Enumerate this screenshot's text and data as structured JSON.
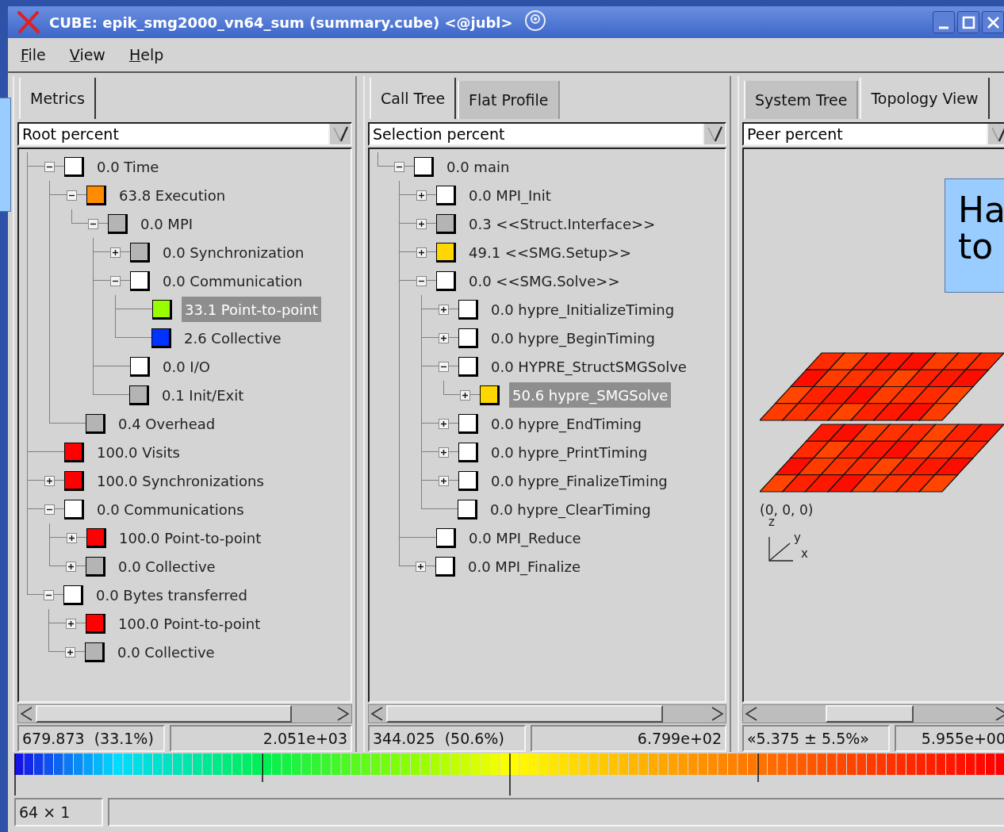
{
  "window": {
    "title": "CUBE: epik_smg2000_vn64_sum (summary.cube) <@jubl>"
  },
  "menu": [
    {
      "label": "File"
    },
    {
      "label": "View"
    },
    {
      "label": "Help"
    }
  ],
  "panels": [
    {
      "tabs": [
        {
          "label": "Metrics",
          "selected": true
        }
      ],
      "selector": {
        "value": "Root percent"
      },
      "view": {
        "kind": "tree",
        "nodes": [
          {
            "label": "0.0 Time",
            "kind": "branch",
            "expanded": true,
            "color": "#ffffff",
            "selected": false,
            "children": [
              {
                "label": "63.8 Execution",
                "kind": "branch",
                "expanded": true,
                "color": "#ff8c00",
                "selected": false,
                "children": [
                  {
                    "label": "0.0 MPI",
                    "kind": "branch",
                    "expanded": true,
                    "color": "#b4b4b4",
                    "selected": false,
                    "children": [
                      {
                        "label": "0.0 Synchronization",
                        "kind": "branch",
                        "expanded": false,
                        "color": "#b4b4b4",
                        "selected": false
                      },
                      {
                        "label": "0.0 Communication",
                        "kind": "branch",
                        "expanded": true,
                        "color": "#ffffff",
                        "selected": false,
                        "children": [
                          {
                            "label": "33.1 Point-to-point",
                            "kind": "leaf",
                            "color": "#99ff00",
                            "selected": true
                          },
                          {
                            "label": "2.6 Collective",
                            "kind": "leaf",
                            "color": "#0033ff",
                            "selected": false
                          }
                        ]
                      },
                      {
                        "label": "0.0 I/O",
                        "kind": "leaf",
                        "color": "#ffffff",
                        "selected": false
                      },
                      {
                        "label": "0.1 Init/Exit",
                        "kind": "leaf",
                        "color": "#b4b4b4",
                        "selected": false
                      }
                    ]
                  }
                ]
              },
              {
                "label": "0.4 Overhead",
                "kind": "leaf",
                "color": "#b4b4b4",
                "selected": false
              }
            ]
          },
          {
            "label": "100.0 Visits",
            "kind": "leaf",
            "color": "#ff0000",
            "selected": false
          },
          {
            "label": "100.0 Synchronizations",
            "kind": "branch",
            "expanded": false,
            "color": "#ff0000",
            "selected": false
          },
          {
            "label": "0.0 Communications",
            "kind": "branch",
            "expanded": true,
            "color": "#ffffff",
            "selected": false,
            "children": [
              {
                "label": "100.0 Point-to-point",
                "kind": "branch",
                "expanded": false,
                "color": "#ff0000",
                "selected": false
              },
              {
                "label": "0.0 Collective",
                "kind": "branch",
                "expanded": false,
                "color": "#b4b4b4",
                "selected": false
              }
            ]
          },
          {
            "label": "0.0 Bytes transferred",
            "kind": "branch",
            "expanded": true,
            "color": "#ffffff",
            "selected": false,
            "children": [
              {
                "label": "100.0 Point-to-point",
                "kind": "branch",
                "expanded": false,
                "color": "#ff0000",
                "selected": false
              },
              {
                "label": "0.0 Collective",
                "kind": "branch",
                "expanded": false,
                "color": "#b4b4b4",
                "selected": false
              }
            ]
          }
        ]
      },
      "values": {
        "left": "679.873  (33.1%)",
        "right": "2.051e+03"
      }
    },
    {
      "tabs": [
        {
          "label": "Call Tree",
          "selected": true
        },
        {
          "label": "Flat Profile",
          "selected": false
        }
      ],
      "selector": {
        "value": "Selection percent"
      },
      "view": {
        "kind": "tree",
        "nodes": [
          {
            "label": "0.0 main",
            "kind": "branch",
            "expanded": true,
            "color": "#ffffff",
            "selected": false,
            "children": [
              {
                "label": "0.0 MPI_Init",
                "kind": "branch",
                "expanded": false,
                "color": "#ffffff",
                "selected": false
              },
              {
                "label": "0.3 <<Struct.Interface>>",
                "kind": "branch",
                "expanded": false,
                "color": "#b4b4b4",
                "selected": false
              },
              {
                "label": "49.1 <<SMG.Setup>>",
                "kind": "branch",
                "expanded": false,
                "color": "#ffd700",
                "selected": false
              },
              {
                "label": "0.0 <<SMG.Solve>>",
                "kind": "branch",
                "expanded": true,
                "color": "#ffffff",
                "selected": false,
                "children": [
                  {
                    "label": "0.0 hypre_InitializeTiming",
                    "kind": "branch",
                    "expanded": false,
                    "color": "#ffffff",
                    "selected": false
                  },
                  {
                    "label": "0.0 hypre_BeginTiming",
                    "kind": "branch",
                    "expanded": false,
                    "color": "#ffffff",
                    "selected": false
                  },
                  {
                    "label": "0.0 HYPRE_StructSMGSolve",
                    "kind": "branch",
                    "expanded": true,
                    "color": "#ffffff",
                    "selected": false,
                    "children": [
                      {
                        "label": "50.6 hypre_SMGSolve",
                        "kind": "branch",
                        "expanded": false,
                        "color": "#ffd700",
                        "selected": true
                      }
                    ]
                  },
                  {
                    "label": "0.0 hypre_EndTiming",
                    "kind": "branch",
                    "expanded": false,
                    "color": "#ffffff",
                    "selected": false
                  },
                  {
                    "label": "0.0 hypre_PrintTiming",
                    "kind": "branch",
                    "expanded": false,
                    "color": "#ffffff",
                    "selected": false
                  },
                  {
                    "label": "0.0 hypre_FinalizeTiming",
                    "kind": "branch",
                    "expanded": false,
                    "color": "#ffffff",
                    "selected": false
                  },
                  {
                    "label": "0.0 hypre_ClearTiming",
                    "kind": "leaf",
                    "color": "#ffffff",
                    "selected": false
                  }
                ]
              },
              {
                "label": "0.0 MPI_Reduce",
                "kind": "leaf",
                "color": "#ffffff",
                "selected": false
              },
              {
                "label": "0.0 MPI_Finalize",
                "kind": "branch",
                "expanded": false,
                "color": "#ffffff",
                "selected": false
              }
            ]
          }
        ]
      },
      "values": {
        "left": "344.025  (50.6%)",
        "right": "6.799e+02"
      }
    },
    {
      "tabs": [
        {
          "label": "System Tree",
          "selected": false
        },
        {
          "label": "Topology View",
          "selected": true
        }
      ],
      "selector": {
        "value": "Peer percent"
      },
      "view": {
        "kind": "topology",
        "origin": "(0, 0, 0)",
        "axes": [
          "z",
          "y",
          "x"
        ]
      },
      "values": {
        "left": "«5.375 ± 5.5%»",
        "right": "5.955e+00"
      }
    }
  ],
  "status_bar": {
    "dims": "64 × 1"
  },
  "callouts": [
    {
      "kind": "plain"
    },
    {
      "kind": "text",
      "lines": [
        "Ha",
        "to"
      ]
    }
  ]
}
